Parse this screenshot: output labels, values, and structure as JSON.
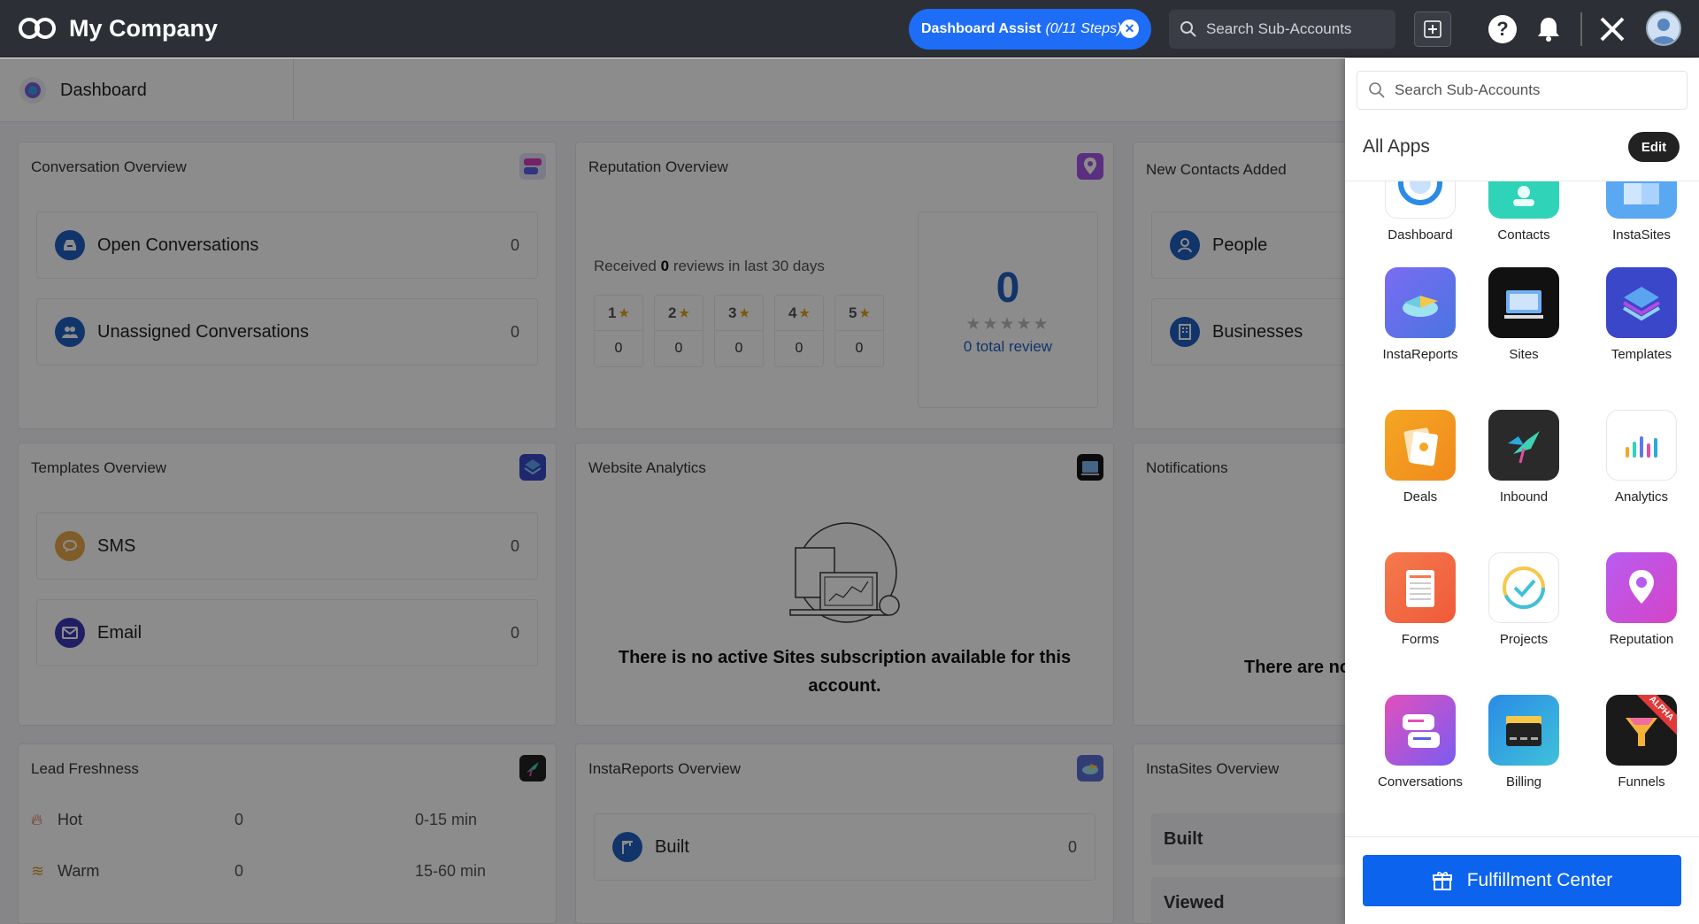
{
  "topbar": {
    "company": "My Company",
    "assist_label": "Dashboard Assist",
    "assist_steps": "(0/11 Steps)",
    "search_placeholder": "Search Sub-Accounts"
  },
  "subbar": {
    "dashboard_tab": "Dashboard"
  },
  "cards": {
    "conversation": {
      "title": "Conversation Overview",
      "rows": [
        {
          "label": "Open Conversations",
          "value": "0"
        },
        {
          "label": "Unassigned Conversations",
          "value": "0"
        }
      ]
    },
    "reputation": {
      "title": "Reputation Overview",
      "received_prefix": "Received",
      "received_count": "0",
      "received_suffix": "reviews in last 30 days",
      "stars": [
        {
          "rating": "1",
          "count": "0"
        },
        {
          "rating": "2",
          "count": "0"
        },
        {
          "rating": "3",
          "count": "0"
        },
        {
          "rating": "4",
          "count": "0"
        },
        {
          "rating": "5",
          "count": "0"
        }
      ],
      "total_number": "0",
      "total_label": "0 total review"
    },
    "contacts": {
      "title": "New Contacts Added",
      "rows": [
        {
          "label": "People"
        },
        {
          "label": "Businesses"
        }
      ]
    },
    "templates": {
      "title": "Templates Overview",
      "rows": [
        {
          "label": "SMS",
          "value": "0"
        },
        {
          "label": "Email",
          "value": "0"
        }
      ]
    },
    "website": {
      "title": "Website Analytics",
      "message": "There is no active Sites subscription available for this account."
    },
    "notifications": {
      "title": "Notifications",
      "message": "There are no"
    },
    "lead": {
      "title": "Lead Freshness",
      "rows": [
        {
          "label": "Hot",
          "value": "0",
          "range": "0-15 min"
        },
        {
          "label": "Warm",
          "value": "0",
          "range": "15-60 min"
        }
      ]
    },
    "instareports": {
      "title": "InstaReports Overview",
      "rows": [
        {
          "label": "Built",
          "value": "0"
        }
      ]
    },
    "instasites": {
      "title": "InstaSites Overview",
      "rows": [
        {
          "label": "Built"
        },
        {
          "label": "Viewed"
        }
      ]
    }
  },
  "panel": {
    "search_placeholder": "Search Sub-Accounts",
    "title": "All Apps",
    "edit_label": "Edit",
    "apps": [
      {
        "label": "Dashboard"
      },
      {
        "label": "Contacts"
      },
      {
        "label": "InstaSites"
      },
      {
        "label": "InstaReports"
      },
      {
        "label": "Sites"
      },
      {
        "label": "Templates"
      },
      {
        "label": "Deals"
      },
      {
        "label": "Inbound"
      },
      {
        "label": "Analytics"
      },
      {
        "label": "Forms"
      },
      {
        "label": "Projects"
      },
      {
        "label": "Reputation"
      },
      {
        "label": "Conversations"
      },
      {
        "label": "Billing"
      },
      {
        "label": "Funnels",
        "badge": "ALPHA"
      }
    ],
    "fulfillment_label": "Fulfillment Center"
  },
  "colors": {
    "accent": "#1e6df6",
    "topbar": "#2c2f36",
    "fulfill": "#0b63ee",
    "star": "#e0a31b"
  }
}
